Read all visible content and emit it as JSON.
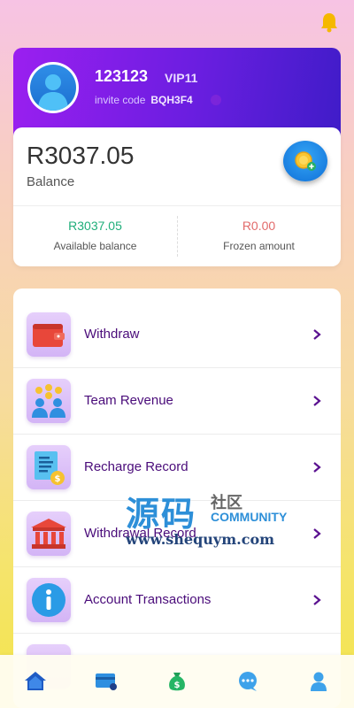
{
  "profile": {
    "username": "123123",
    "vip_level": "VIP11",
    "invite_label": "invite code",
    "invite_code": "BQH3F4"
  },
  "balance": {
    "amount": "R3037.05",
    "label": "Balance",
    "available_value": "R3037.05",
    "available_label": "Available balance",
    "frozen_value": "R0.00",
    "frozen_label": "Frozen amount"
  },
  "menu": {
    "items": [
      {
        "label": "Withdraw",
        "icon": "wallet-icon"
      },
      {
        "label": "Team Revenue",
        "icon": "team-icon"
      },
      {
        "label": "Recharge Record",
        "icon": "receipt-icon"
      },
      {
        "label": "Withdrawal Record",
        "icon": "bank-icon"
      },
      {
        "label": "Account Transactions",
        "icon": "info-icon"
      }
    ]
  },
  "watermark": {
    "cn_big": "源码",
    "cn_small": "社区",
    "community": "COMMUNITY",
    "url": "www.shequym.com"
  },
  "tabs": [
    "home-icon",
    "card-icon",
    "money-bag-icon",
    "chat-icon",
    "user-icon"
  ],
  "colors": {
    "accent_purple": "#6a1ee0",
    "menu_text": "#4a0c7a",
    "available": "#1fae7a",
    "frozen": "#e26a6a",
    "bell": "#f5b800"
  }
}
